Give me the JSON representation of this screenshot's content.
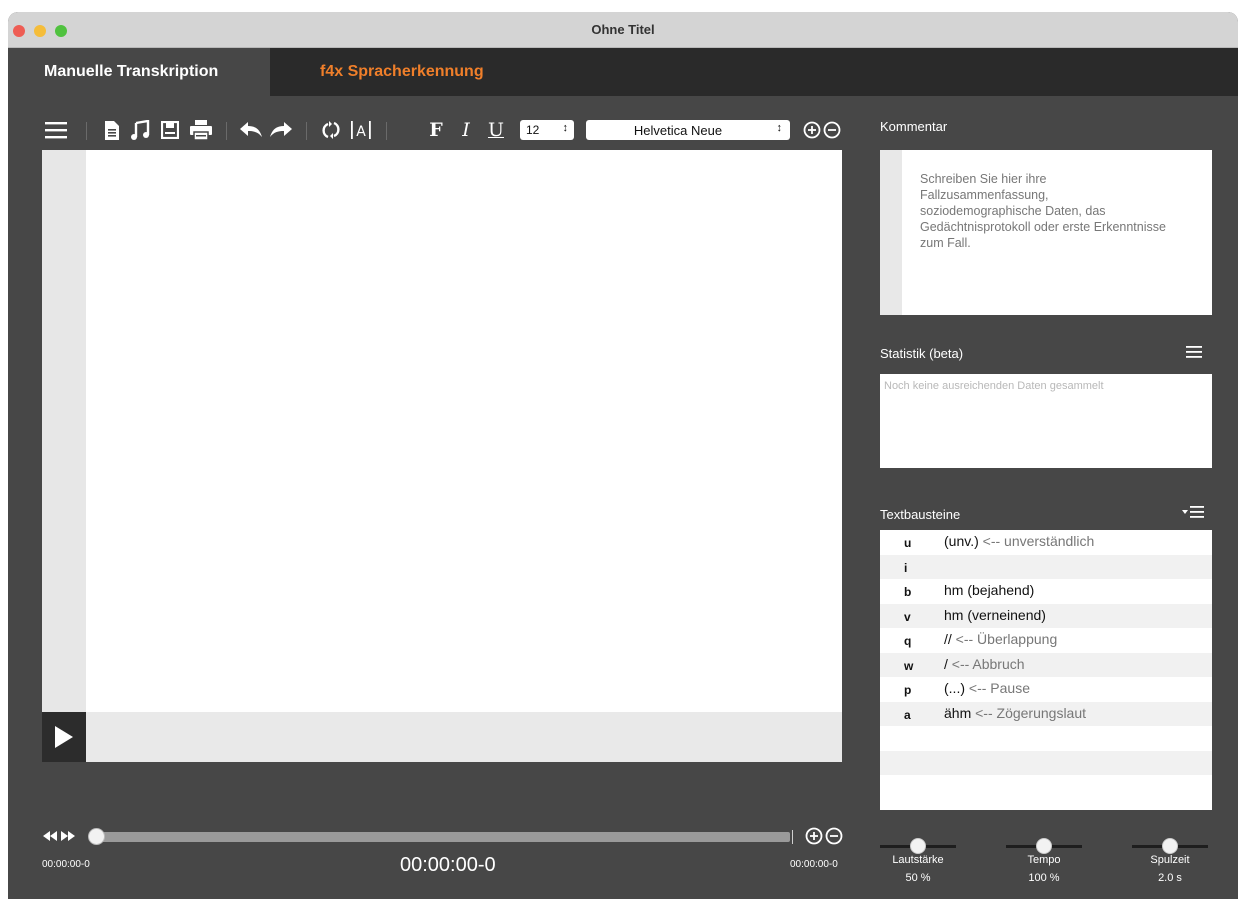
{
  "window": {
    "title": "Ohne Titel"
  },
  "tabs": [
    {
      "label": "Manuelle Transkription",
      "active": true
    },
    {
      "label": "f4x Spracherkennung",
      "active": false,
      "color": "#f07f2a"
    }
  ],
  "toolbar": {
    "icons": [
      "menu-icon",
      "document-icon",
      "music-note-icon",
      "save-icon",
      "print-icon",
      "undo-icon",
      "redo-icon",
      "sync-icon",
      "text-box-icon",
      "zoom-in-icon",
      "zoom-out-icon"
    ],
    "bold_label": "F",
    "italic_label": "I",
    "underline_label": "U",
    "font_size": "12",
    "font_name": "Helvetica Neue",
    "stepper_glyph": "↕"
  },
  "player": {
    "time_start": "00:00:00-0",
    "time_current": "00:00:00-0",
    "time_end": "00:00:00-0",
    "position": 0
  },
  "comment": {
    "label": "Kommentar",
    "placeholder": "Schreiben Sie hier ihre Fallzusammenfassung, soziodemographische Daten, das Gedächtnisprotokoll oder erste Erkenntnisse zum Fall."
  },
  "statistics": {
    "label": "Statistik (beta)",
    "empty_text": "Noch keine ausreichenden Daten gesammelt"
  },
  "textbausteine": {
    "label": "Textbausteine",
    "items": [
      {
        "key": "u",
        "text": "(unv.)",
        "desc": " <-- unverständlich"
      },
      {
        "key": "i",
        "text": "",
        "desc": ""
      },
      {
        "key": "b",
        "text": "hm (bejahend)",
        "desc": ""
      },
      {
        "key": "v",
        "text": "hm (verneinend)",
        "desc": ""
      },
      {
        "key": "q",
        "text": "//",
        "desc": " <-- Überlappung"
      },
      {
        "key": "w",
        "text": "/",
        "desc": " <-- Abbruch"
      },
      {
        "key": "p",
        "text": "(...)",
        "desc": " <-- Pause"
      },
      {
        "key": "a",
        "text": "ähm",
        "desc": " <-- Zögerungslaut"
      },
      {
        "key": "",
        "text": "",
        "desc": ""
      },
      {
        "key": "",
        "text": "",
        "desc": ""
      },
      {
        "key": "",
        "text": "",
        "desc": ""
      }
    ]
  },
  "sliders": [
    {
      "name": "Lautstärke",
      "value": "50 %",
      "level": 0.5
    },
    {
      "name": "Tempo",
      "value": "100 %",
      "level": 0.5
    },
    {
      "name": "Spulzeit",
      "value": "2.0 s",
      "level": 0.5
    }
  ]
}
